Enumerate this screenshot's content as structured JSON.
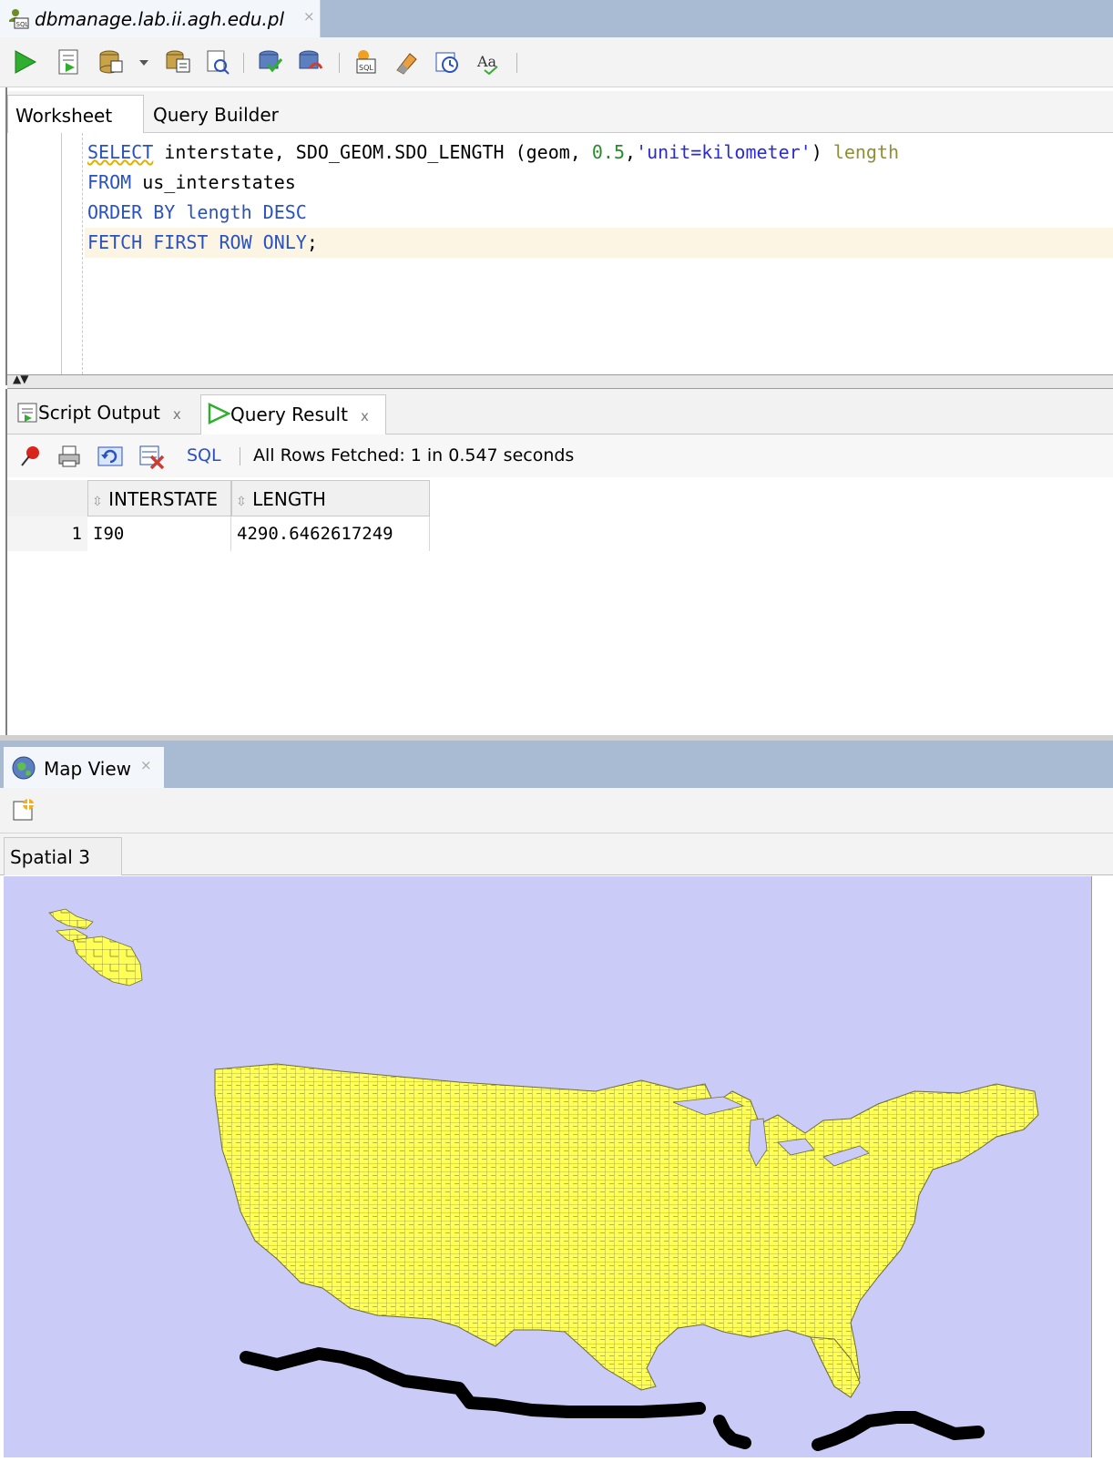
{
  "document_tab": {
    "title": "dbmanage.lab.ii.agh.edu.pl",
    "close": "×"
  },
  "toolbar": {
    "buttons": [
      "run-statement",
      "run-script",
      "autotrace",
      "explain-plan",
      "sql-tuning",
      "commit",
      "rollback",
      "unshared-sql",
      "clear",
      "history",
      "format"
    ]
  },
  "worksheet_tabs": [
    "Worksheet",
    "Query Builder"
  ],
  "editor": {
    "line1": {
      "kw1": "SELECT",
      "rest1": " interstate, SDO_GEOM.SDO_LENGTH (geom, ",
      "num": "0.5",
      "comma": ",",
      "str": "'unit=kilometer'",
      "paren": ") ",
      "alias": "length"
    },
    "line2": {
      "kw": "FROM",
      "rest": " us_interstates"
    },
    "line3": {
      "kw": "ORDER BY length DESC"
    },
    "line4": {
      "kw": "FETCH FIRST ROW ONLY",
      "semi": ";"
    }
  },
  "results": {
    "tabs": [
      {
        "label": "Script Output",
        "close": "x"
      },
      {
        "label": "Query Result",
        "close": "x"
      }
    ],
    "sql_link": "SQL",
    "status": "All Rows Fetched: 1 in 0.547 seconds",
    "columns": [
      "INTERSTATE",
      "LENGTH"
    ],
    "rows": [
      {
        "num": "1",
        "interstate": "I90",
        "length": "4290.6462617249"
      }
    ]
  },
  "map_view": {
    "tab_label": "Map View",
    "close": "×",
    "layer_tab": "Spatial 3",
    "colors": {
      "water": "#cacbf6",
      "land": "#ffff55",
      "route": "#000000"
    }
  }
}
